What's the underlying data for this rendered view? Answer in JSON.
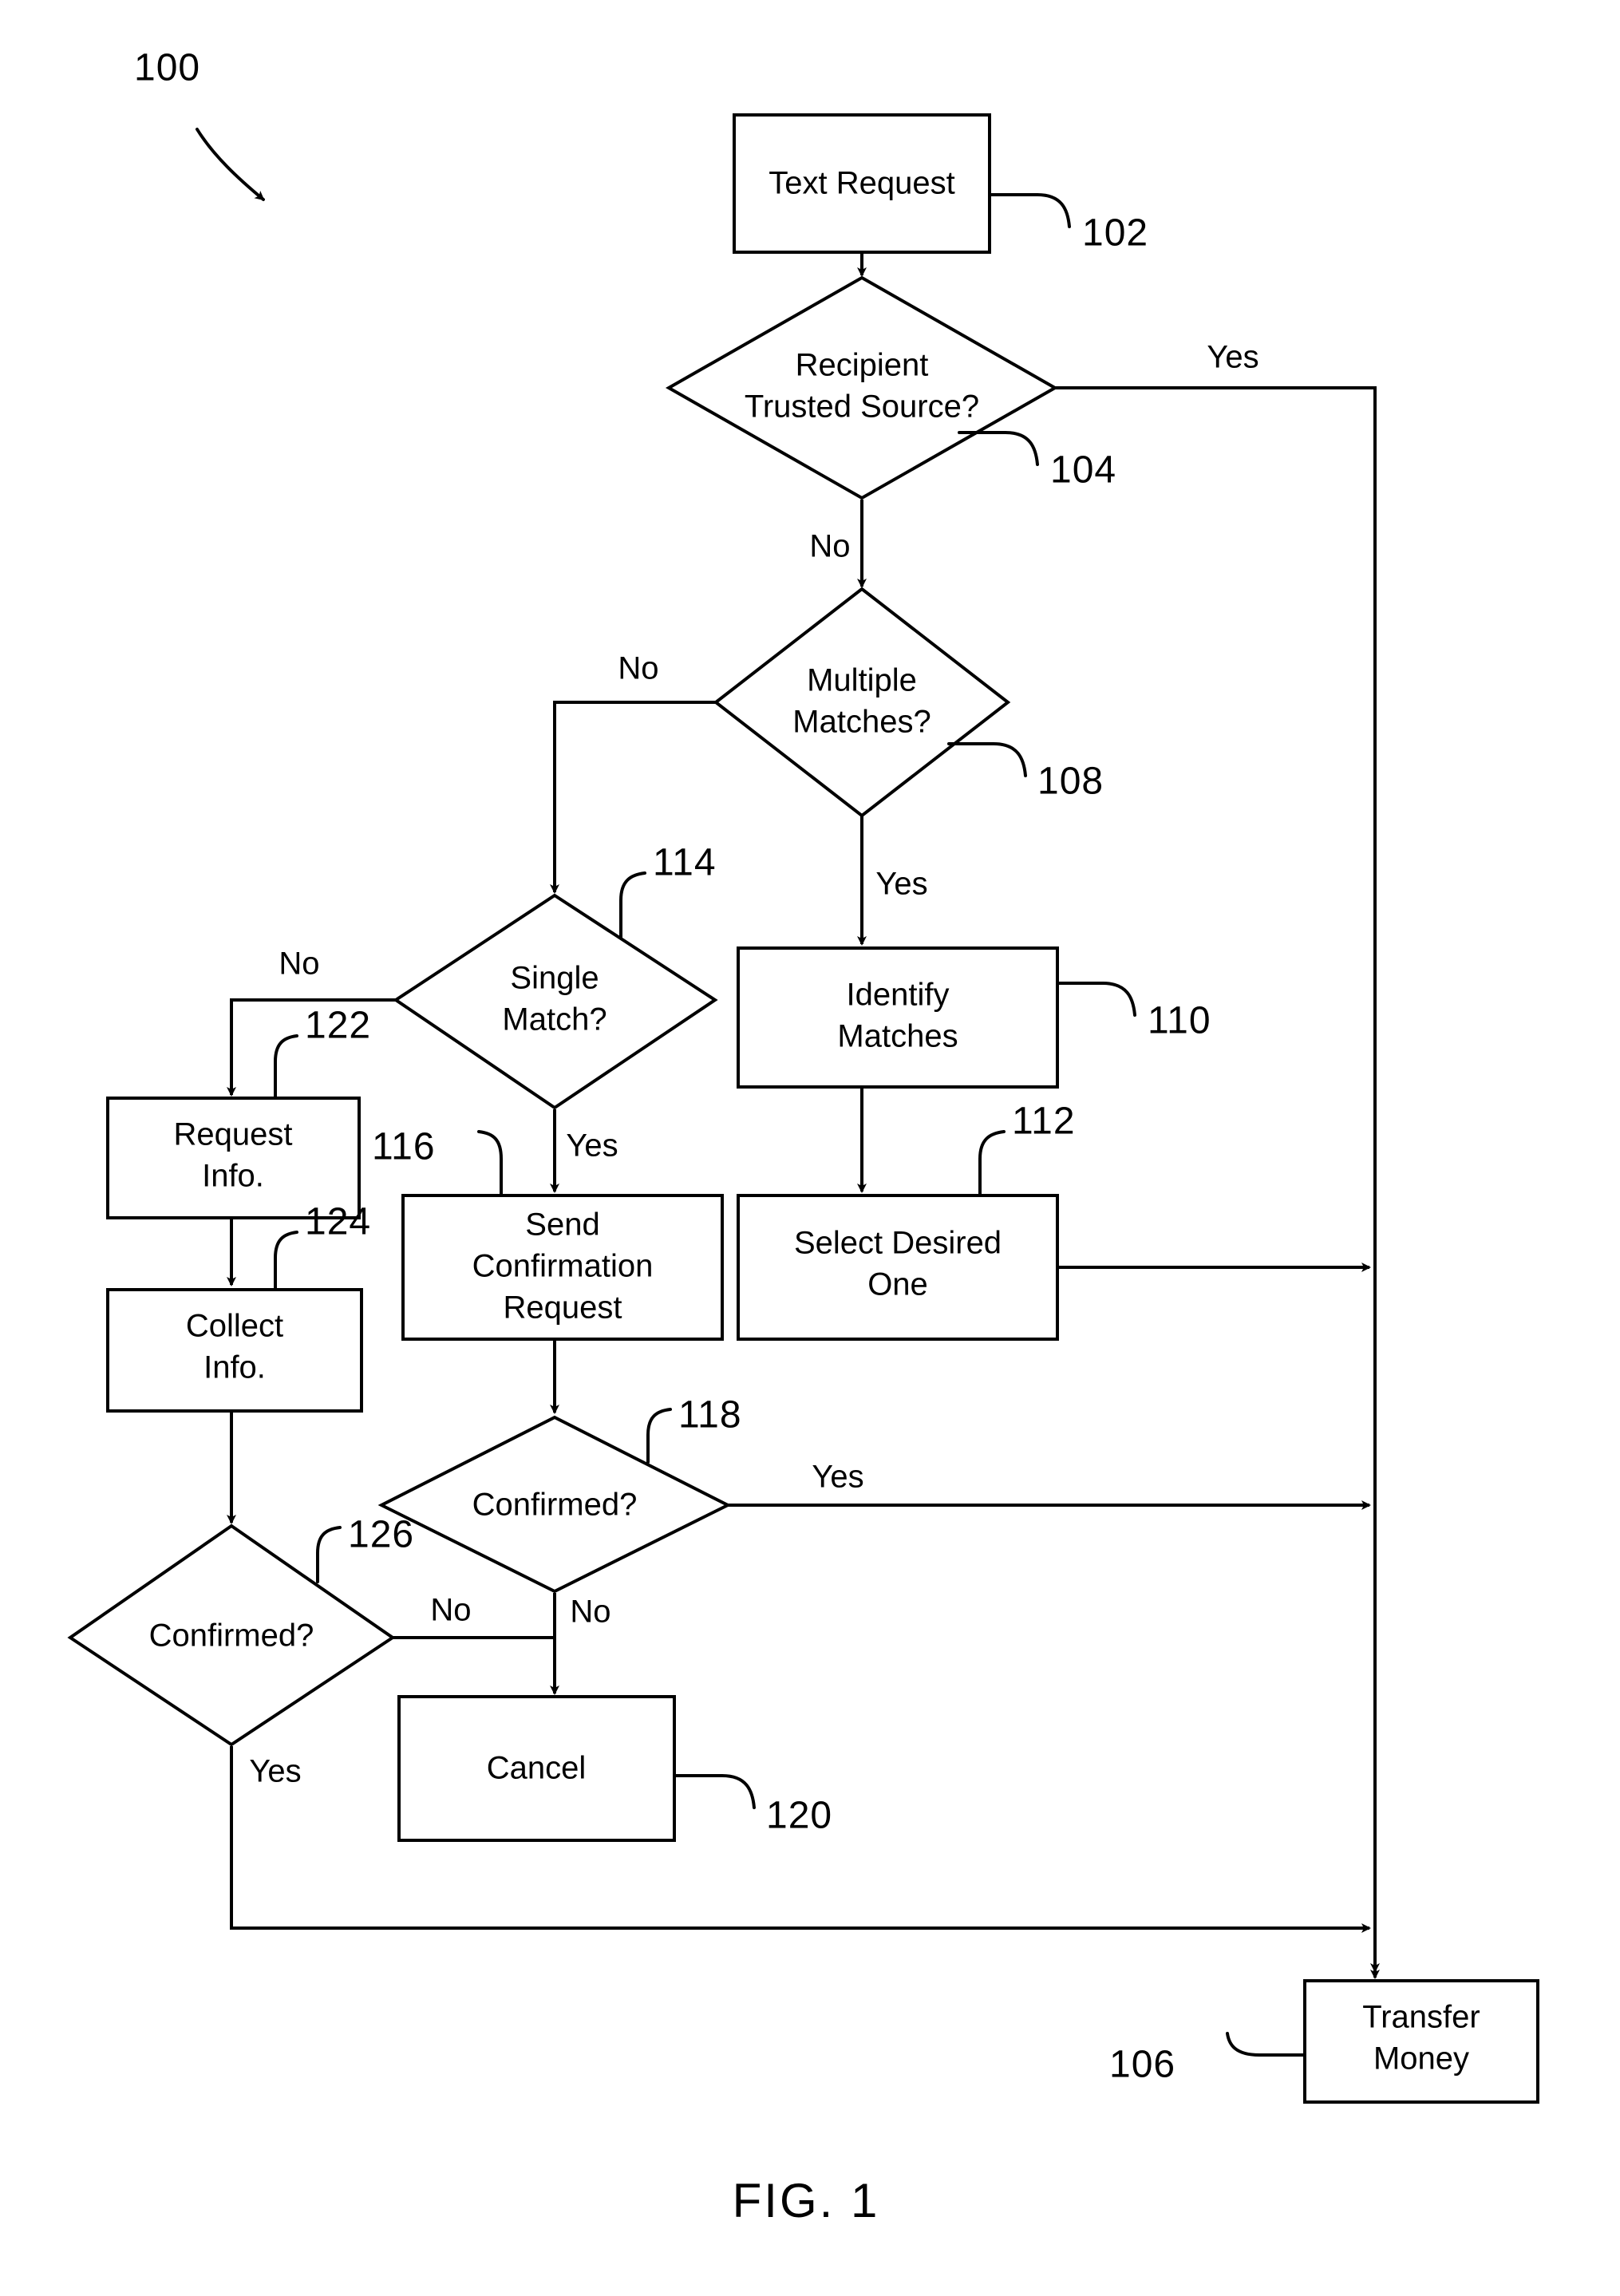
{
  "figure": {
    "caption": "FIG. 1",
    "diagram_number": "100",
    "title_text": "FIG. 1"
  },
  "nodes": [
    {
      "id": "102",
      "ref": "102",
      "shape": "process",
      "label": "Text Request",
      "lines": [
        "Text Request"
      ]
    },
    {
      "id": "104",
      "ref": "104",
      "shape": "decision",
      "label": "Recipient Trusted Source?",
      "lines": [
        "Recipient",
        "Trusted Source?"
      ]
    },
    {
      "id": "108",
      "ref": "108",
      "shape": "decision",
      "label": "Multiple Matches?",
      "lines": [
        "Multiple",
        "Matches?"
      ]
    },
    {
      "id": "110",
      "ref": "110",
      "shape": "process",
      "label": "Identify Matches",
      "lines": [
        "Identify",
        "Matches"
      ]
    },
    {
      "id": "112",
      "ref": "112",
      "shape": "process",
      "label": "Select Desired One",
      "lines": [
        "Select Desired",
        "One"
      ]
    },
    {
      "id": "114",
      "ref": "114",
      "shape": "decision",
      "label": "Single Match?",
      "lines": [
        "Single",
        "Match?"
      ]
    },
    {
      "id": "116",
      "ref": "116",
      "shape": "process",
      "label": "Send Confirmation Request",
      "lines": [
        "Send",
        "Confirmation",
        "Request"
      ]
    },
    {
      "id": "118",
      "ref": "118",
      "shape": "decision",
      "label": "Confirmed?",
      "lines": [
        "Confirmed?"
      ]
    },
    {
      "id": "120",
      "ref": "120",
      "shape": "process",
      "label": "Cancel",
      "lines": [
        "Cancel"
      ]
    },
    {
      "id": "122",
      "ref": "122",
      "shape": "process",
      "label": "Request Info.",
      "lines": [
        "Request",
        "Info."
      ]
    },
    {
      "id": "124",
      "ref": "124",
      "shape": "process",
      "label": "Collect Info.",
      "lines": [
        "Collect",
        "Info."
      ]
    },
    {
      "id": "126",
      "ref": "126",
      "shape": "decision",
      "label": "Confirmed?",
      "lines": [
        "Confirmed?"
      ]
    },
    {
      "id": "106",
      "ref": "106",
      "shape": "process",
      "label": "Transfer Money",
      "lines": [
        "Transfer",
        "Money"
      ]
    }
  ],
  "node_text": {
    "n102_l1": "Text Request",
    "n104_l1": "Recipient",
    "n104_l2": "Trusted Source?",
    "n108_l1": "Multiple",
    "n108_l2": "Matches?",
    "n110_l1": "Identify",
    "n110_l2": "Matches",
    "n112_l1": "Select Desired",
    "n112_l2": "One",
    "n114_l1": "Single",
    "n114_l2": "Match?",
    "n116_l1": "Send",
    "n116_l2": "Confirmation",
    "n116_l3": "Request",
    "n118_l1": "Confirmed?",
    "n120_l1": "Cancel",
    "n122_l1": "Request",
    "n122_l2": "Info.",
    "n124_l1": "Collect",
    "n124_l2": "Info.",
    "n126_l1": "Confirmed?",
    "n106_l1": "Transfer",
    "n106_l2": "Money"
  },
  "reference_numerals": {
    "r100": "100",
    "r102": "102",
    "r104": "104",
    "r106": "106",
    "r108": "108",
    "r110": "110",
    "r112": "112",
    "r114": "114",
    "r116": "116",
    "r118": "118",
    "r120": "120",
    "r122": "122",
    "r124": "124",
    "r126": "126"
  },
  "edge_labels": {
    "e104_yes": "Yes",
    "e104_no": "No",
    "e108_no": "No",
    "e108_yes": "Yes",
    "e114_no": "No",
    "e114_yes": "Yes",
    "e118_yes": "Yes",
    "e118_no": "No",
    "e126_no": "No",
    "e126_yes": "Yes"
  },
  "edges": [
    {
      "from": "102",
      "to": "104",
      "label": ""
    },
    {
      "from": "104",
      "to": "106",
      "label": "Yes"
    },
    {
      "from": "104",
      "to": "108",
      "label": "No"
    },
    {
      "from": "108",
      "to": "114",
      "label": "No"
    },
    {
      "from": "108",
      "to": "110",
      "label": "Yes"
    },
    {
      "from": "110",
      "to": "112",
      "label": ""
    },
    {
      "from": "112",
      "to": "106",
      "label": ""
    },
    {
      "from": "114",
      "to": "122",
      "label": "No"
    },
    {
      "from": "114",
      "to": "116",
      "label": "Yes"
    },
    {
      "from": "116",
      "to": "118",
      "label": ""
    },
    {
      "from": "118",
      "to": "106",
      "label": "Yes"
    },
    {
      "from": "118",
      "to": "120",
      "label": "No"
    },
    {
      "from": "122",
      "to": "124",
      "label": ""
    },
    {
      "from": "124",
      "to": "126",
      "label": ""
    },
    {
      "from": "126",
      "to": "120",
      "label": "No"
    },
    {
      "from": "126",
      "to": "106",
      "label": "Yes"
    }
  ],
  "style": {
    "line_color": "#000000",
    "fill_color": "#ffffff",
    "background": "#ffffff"
  }
}
